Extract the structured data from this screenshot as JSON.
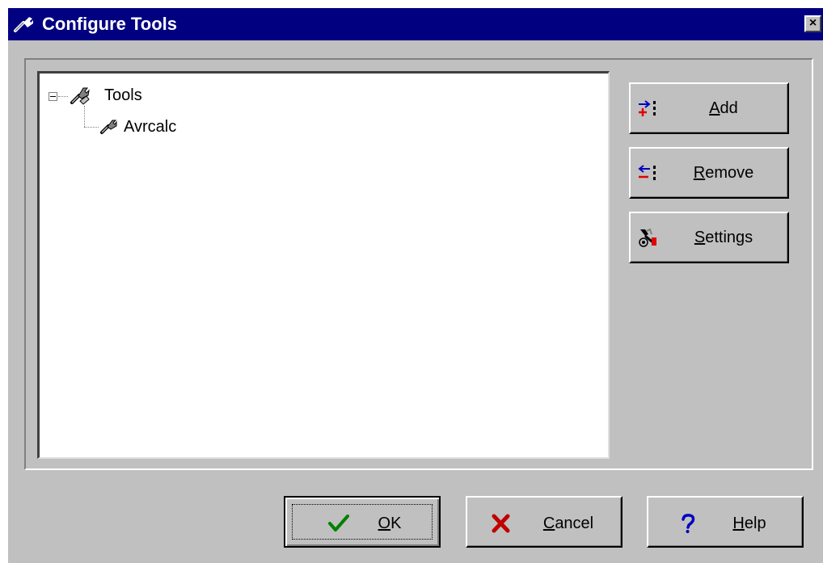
{
  "window": {
    "title": "Configure Tools",
    "close_label": "×"
  },
  "tree": {
    "root_label": "Tools",
    "child_label": "Avrcalc"
  },
  "side_buttons": {
    "add": {
      "mnemonic": "A",
      "rest": "dd"
    },
    "remove": {
      "mnemonic": "R",
      "rest": "emove"
    },
    "settings": {
      "mnemonic": "S",
      "rest": "ettings"
    }
  },
  "bottom_buttons": {
    "ok": {
      "mnemonic": "O",
      "rest": "K"
    },
    "cancel": {
      "mnemonic": "C",
      "rest": "ancel"
    },
    "help": {
      "mnemonic": "H",
      "rest": "elp"
    }
  },
  "icons": {
    "title": "wrench-icon",
    "tree_root": "tools-wrench-icon",
    "tree_child": "wrench-icon",
    "add": "add-arrow-icon",
    "remove": "remove-arrow-icon",
    "settings": "settings-icon",
    "ok": "checkmark-icon",
    "cancel": "x-mark-icon",
    "help": "question-mark-icon"
  },
  "colors": {
    "titlebar": "#000080",
    "face": "#c0c0c0",
    "ok_check": "#008000",
    "cancel_x": "#c00000",
    "help_q": "#0000c0"
  }
}
